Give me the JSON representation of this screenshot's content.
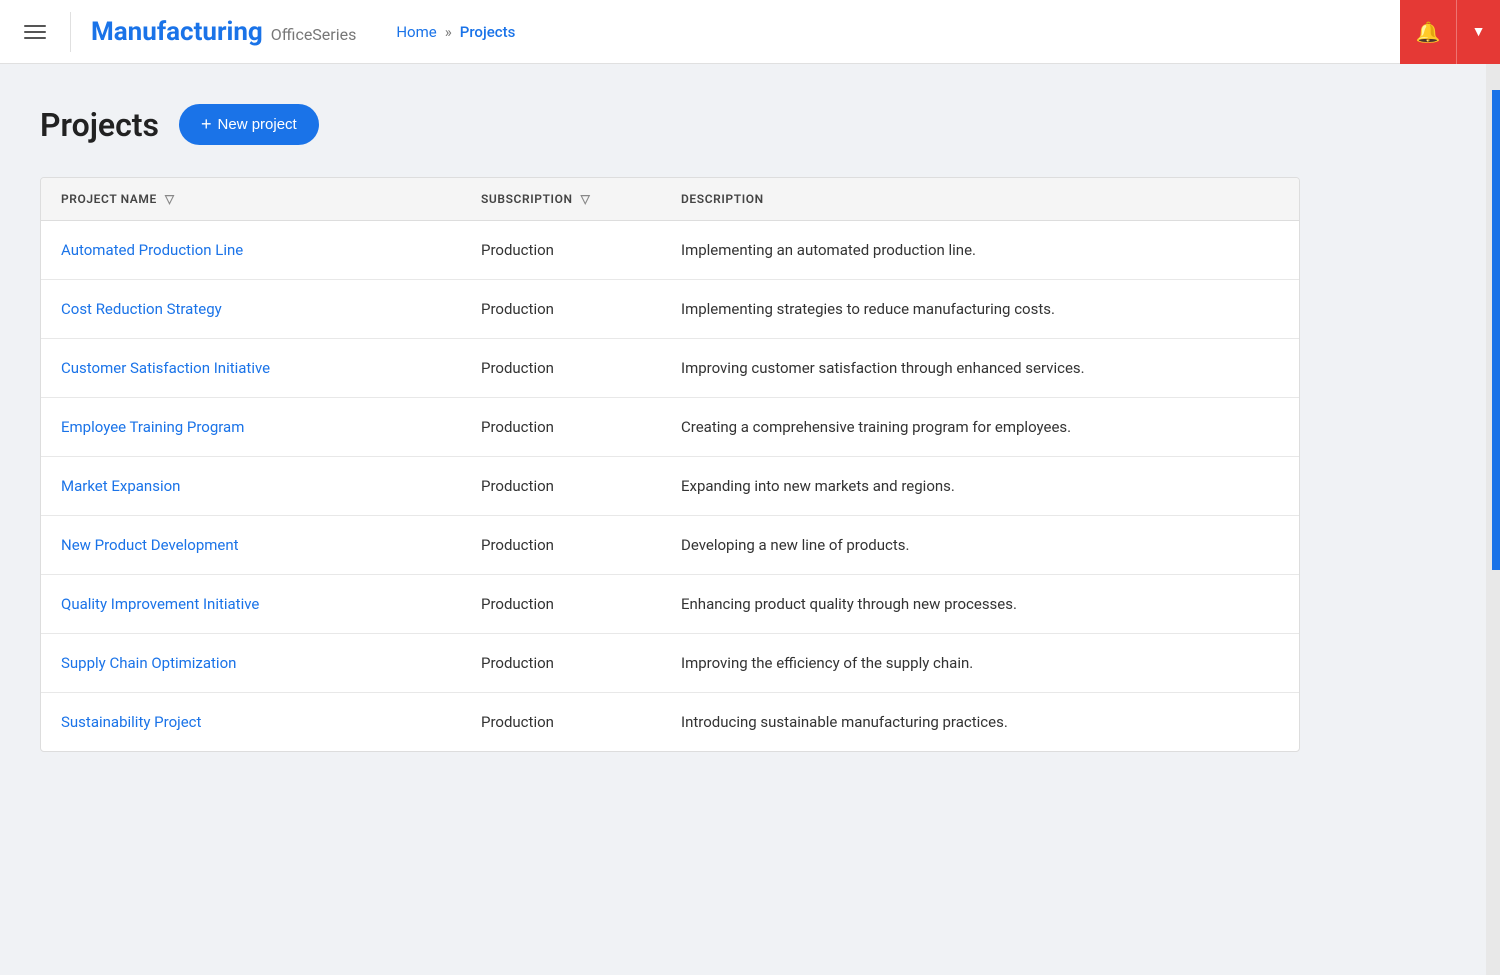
{
  "header": {
    "brand_name": "Manufacturing",
    "brand_sub": "OfficeSeries",
    "nav_home": "Home",
    "nav_separator": "»",
    "nav_current": "Projects"
  },
  "page": {
    "title": "Projects",
    "new_project_btn": "+ New project",
    "new_project_plus": "+",
    "new_project_label": "New project"
  },
  "table": {
    "columns": [
      {
        "key": "project_name",
        "label": "PROJECT NAME",
        "filterable": true
      },
      {
        "key": "subscription",
        "label": "SUBSCRIPTION",
        "filterable": true
      },
      {
        "key": "description",
        "label": "DESCRIPTION",
        "filterable": false
      }
    ],
    "rows": [
      {
        "project_name": "Automated Production Line",
        "subscription": "Production",
        "description": "Implementing an automated production line."
      },
      {
        "project_name": "Cost Reduction Strategy",
        "subscription": "Production",
        "description": "Implementing strategies to reduce manufacturing costs."
      },
      {
        "project_name": "Customer Satisfaction Initiative",
        "subscription": "Production",
        "description": "Improving customer satisfaction through enhanced services."
      },
      {
        "project_name": "Employee Training Program",
        "subscription": "Production",
        "description": "Creating a comprehensive training program for employees."
      },
      {
        "project_name": "Market Expansion",
        "subscription": "Production",
        "description": "Expanding into new markets and regions."
      },
      {
        "project_name": "New Product Development",
        "subscription": "Production",
        "description": "Developing a new line of products."
      },
      {
        "project_name": "Quality Improvement Initiative",
        "subscription": "Production",
        "description": "Enhancing product quality through new processes."
      },
      {
        "project_name": "Supply Chain Optimization",
        "subscription": "Production",
        "description": "Improving the efficiency of the supply chain."
      },
      {
        "project_name": "Sustainability Project",
        "subscription": "Production",
        "description": "Introducing sustainable manufacturing practices."
      }
    ]
  },
  "colors": {
    "brand_blue": "#1a73e8",
    "header_red": "#e53935",
    "link_color": "#1a73e8",
    "table_header_bg": "#f5f5f5"
  }
}
